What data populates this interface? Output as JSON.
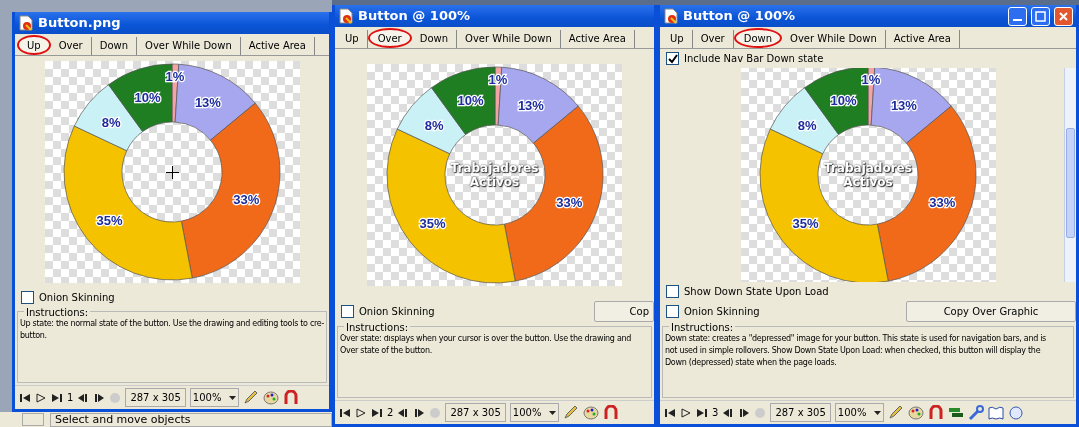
{
  "windows": [
    {
      "title": "Button.png",
      "window_controls": false,
      "scrollbar": false,
      "tabs": [
        {
          "label": "Up",
          "selected": true
        },
        {
          "label": "Over",
          "selected": false
        },
        {
          "label": "Down",
          "selected": false
        },
        {
          "label": "Over While Down",
          "selected": false
        },
        {
          "label": "Active Area",
          "selected": false
        }
      ],
      "canvas": {
        "crosshair": true,
        "chart_data": {
          "type": "donut",
          "values": [
            1,
            13,
            33,
            35,
            8,
            10
          ],
          "value_labels": [
            "1%",
            "13%",
            "33%",
            "35%",
            "8%",
            "10%"
          ]
        }
      },
      "bottom_checkboxes": [
        {
          "label": "Onion Skinning",
          "checked": false
        }
      ],
      "instructions": {
        "legend": "Instructions:",
        "lines": [
          "Up state: the normal state of the button. Use the drawing and editing tools to cre-",
          "button."
        ]
      },
      "toolbar": {
        "frame": "1",
        "size": "287 x 305",
        "zoom": "100%",
        "extended_tools": false
      }
    },
    {
      "title": "Button @  100%",
      "window_controls": false,
      "scrollbar": false,
      "tabs": [
        {
          "label": "Up",
          "selected": false
        },
        {
          "label": "Over",
          "selected": true
        },
        {
          "label": "Down",
          "selected": false
        },
        {
          "label": "Over While Down",
          "selected": false
        },
        {
          "label": "Active Area",
          "selected": false
        }
      ],
      "canvas": {
        "center_text": "Trabajadores Activos",
        "crosshair": false,
        "chart_data": {
          "type": "donut",
          "values": [
            1,
            13,
            33,
            35,
            8,
            10
          ],
          "value_labels": [
            "1%",
            "13%",
            "33%",
            "35%",
            "8%",
            "10%"
          ]
        }
      },
      "bottom_checkboxes": [
        {
          "label": "Onion Skinning",
          "checked": false
        }
      ],
      "copy_button": "Cop",
      "instructions": {
        "legend": "Instructions:",
        "lines": [
          "Over state: displays when your cursor is over the button. Use the drawing and",
          "Over state of the button."
        ]
      },
      "toolbar": {
        "frame": "2",
        "size": "287 x 305",
        "zoom": "100%",
        "extended_tools": false
      }
    },
    {
      "title": "Button @  100%",
      "window_controls": true,
      "scrollbar": true,
      "tabs": [
        {
          "label": "Up",
          "selected": false
        },
        {
          "label": "Over",
          "selected": false
        },
        {
          "label": "Down",
          "selected": true
        },
        {
          "label": "Over While Down",
          "selected": false
        },
        {
          "label": "Active Area",
          "selected": false
        }
      ],
      "top_checkboxes": [
        {
          "label": "Include Nav Bar Down state",
          "checked": true
        }
      ],
      "canvas": {
        "center_text": "Trabajadores Activos",
        "crosshair": false,
        "chart_data": {
          "type": "donut",
          "values": [
            1,
            13,
            33,
            35,
            8,
            10
          ],
          "value_labels": [
            "1%",
            "13%",
            "33%",
            "35%",
            "8%",
            "10%"
          ]
        }
      },
      "bottom_checkboxes": [
        {
          "label": "Show Down State Upon Load",
          "checked": false
        },
        {
          "label": "Onion Skinning",
          "checked": false
        }
      ],
      "copy_button": "Copy Over Graphic",
      "instructions": {
        "legend": "Instructions:",
        "lines": [
          "Down state: creates a \"depressed\" image for your button. This state is used for navigation bars, and is",
          "not used in simple rollovers. Show Down State Upon Load: when checked, this button will display the",
          "Down (depressed) state when the page loads."
        ]
      },
      "toolbar": {
        "frame": "3",
        "size": "287 x 305",
        "zoom": "100%",
        "extended_tools": true
      }
    }
  ],
  "status_bar": {
    "text": "Select and move objects"
  }
}
